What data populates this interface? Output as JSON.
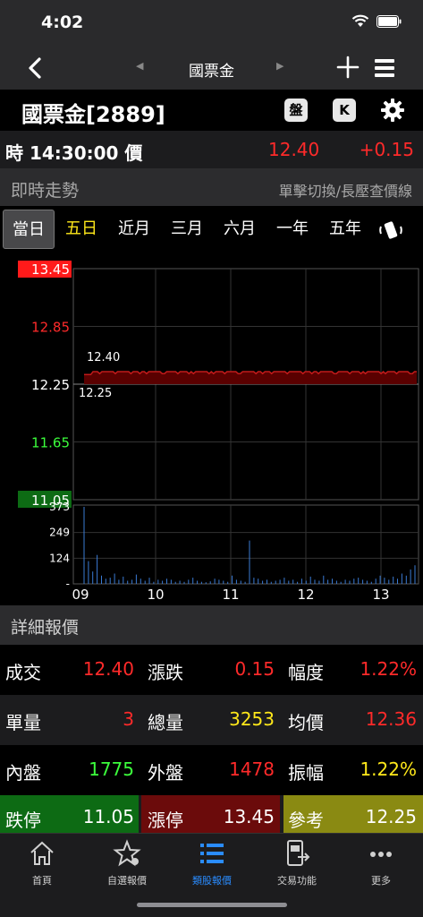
{
  "status": {
    "time": "4:02"
  },
  "nav": {
    "title": "國票金"
  },
  "stock": {
    "name": "國票金[2889]",
    "btn_pan": "盤",
    "btn_k": "K"
  },
  "quote_row": {
    "label": "時 14:30:00 價",
    "price": "12.40",
    "change": "+0.15"
  },
  "intraday": {
    "title": "即時走勢",
    "hint": "單擊切換/長壓查價線"
  },
  "periods": [
    "當日",
    "五日",
    "近月",
    "三月",
    "六月",
    "一年",
    "五年"
  ],
  "chart_data": {
    "type": "line",
    "price_axis": [
      "13.45",
      "12.85",
      "12.25",
      "11.65",
      "11.05"
    ],
    "volume_axis": [
      "373",
      "249",
      "124",
      "-"
    ],
    "time_axis": [
      "09",
      "10",
      "11",
      "12",
      "13"
    ],
    "price_series": {
      "name": "",
      "start": 12.35,
      "high": 12.4,
      "low": 12.35,
      "reference": 12.25
    },
    "price_labels": [
      "12.40",
      "12.25"
    ],
    "ylim": [
      11.05,
      13.45
    ],
    "volume_max": 373,
    "volumes": [
      373,
      110,
      60,
      140,
      40,
      25,
      30,
      50,
      20,
      35,
      15,
      20,
      45,
      25,
      15,
      30,
      10,
      20,
      15,
      25,
      20,
      10,
      15,
      10,
      20,
      30,
      15,
      10,
      8,
      12,
      25,
      20,
      15,
      10,
      40,
      20,
      15,
      10,
      210,
      30,
      25,
      15,
      20,
      10,
      15,
      20,
      30,
      15,
      20,
      10,
      25,
      15,
      35,
      20,
      15,
      40,
      20,
      25,
      15,
      10,
      20,
      15,
      25,
      30,
      20,
      15,
      10,
      25,
      40,
      30,
      20,
      35,
      25,
      50,
      40,
      70,
      90
    ]
  },
  "detail": {
    "title": "詳細報價",
    "rows": [
      [
        {
          "label": "成交",
          "value": "12.40",
          "color": "#ff2a2a"
        },
        {
          "label": "漲跌",
          "value": "0.15",
          "color": "#ff2a2a"
        },
        {
          "label": "幅度",
          "value": "1.22%",
          "color": "#ff2a2a"
        }
      ],
      [
        {
          "label": "單量",
          "value": "3",
          "color": "#ff2a2a"
        },
        {
          "label": "總量",
          "value": "3253",
          "color": "#ffe81a"
        },
        {
          "label": "均價",
          "value": "12.36",
          "color": "#ff2a2a"
        }
      ],
      [
        {
          "label": "內盤",
          "value": "1775",
          "color": "#3cff3c"
        },
        {
          "label": "外盤",
          "value": "1478",
          "color": "#ff2a2a"
        },
        {
          "label": "振幅",
          "value": "1.22%",
          "color": "#ffe81a"
        }
      ],
      [
        {
          "label": "跌停",
          "value": "11.05",
          "color": "#ffffff",
          "bg": "#0d6b14"
        },
        {
          "label": "漲停",
          "value": "13.45",
          "color": "#ffffff",
          "bg": "#6b0b0b"
        },
        {
          "label": "參考",
          "value": "12.25",
          "color": "#ffffff",
          "bg": "#8a8a12"
        }
      ]
    ]
  },
  "tabbar": [
    {
      "label": "首頁",
      "icon": "home-icon"
    },
    {
      "label": "自選報價",
      "icon": "star-icon"
    },
    {
      "label": "類股報價",
      "icon": "list-icon",
      "active": true
    },
    {
      "label": "交易功能",
      "icon": "trade-icon"
    },
    {
      "label": "更多",
      "icon": "more-icon"
    }
  ],
  "colors": {
    "up": "#ff2a2a",
    "down": "#3cff3c",
    "flat": "#ffe81a",
    "accent": "#2a8cff"
  }
}
